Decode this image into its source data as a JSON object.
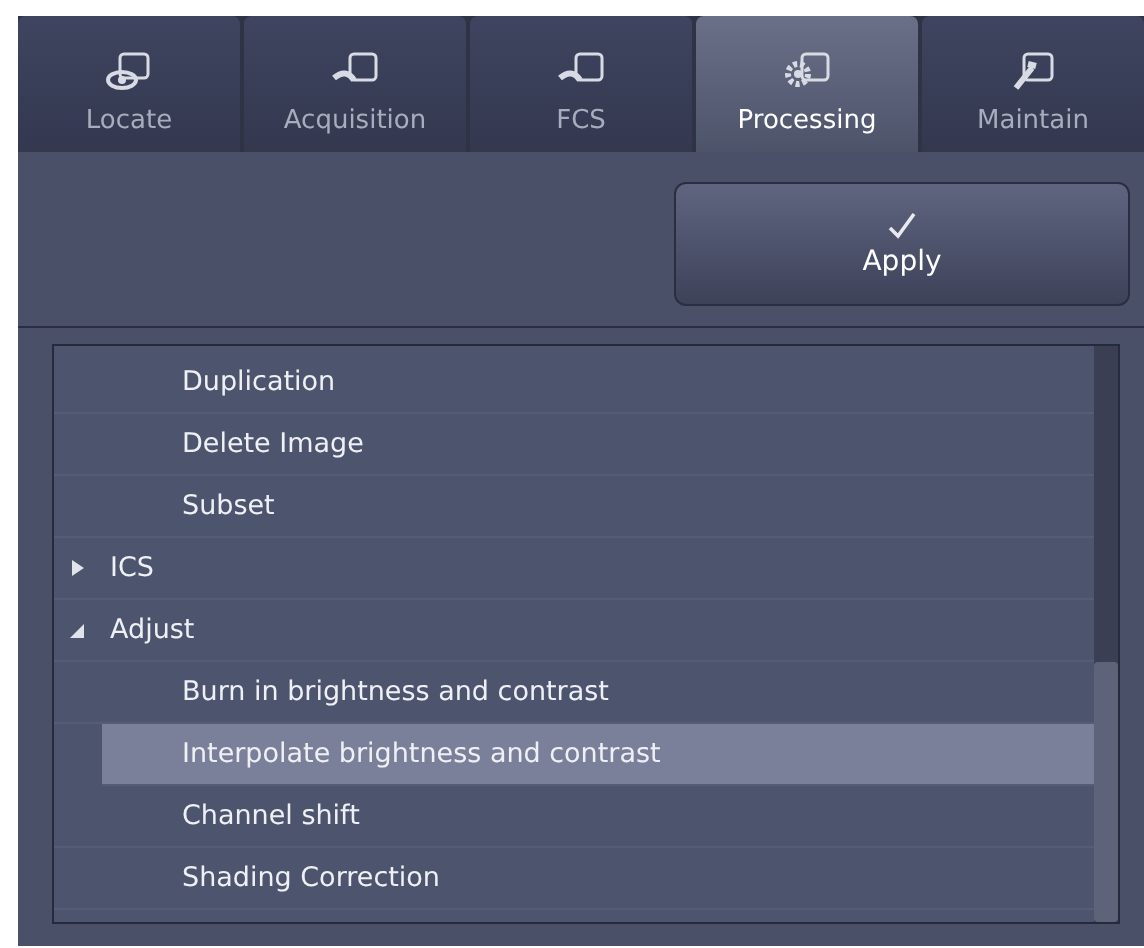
{
  "tabs": [
    {
      "label": "Locate",
      "selected": false
    },
    {
      "label": "Acquisition",
      "selected": false
    },
    {
      "label": "FCS",
      "selected": false
    },
    {
      "label": "Processing",
      "selected": true
    },
    {
      "label": "Maintain",
      "selected": false
    }
  ],
  "apply_button": {
    "label": "Apply"
  },
  "tree": [
    {
      "kind": "leaf",
      "label": "Duplication",
      "selected": false
    },
    {
      "kind": "leaf",
      "label": "Delete Image",
      "selected": false
    },
    {
      "kind": "leaf",
      "label": "Subset",
      "selected": false
    },
    {
      "kind": "group",
      "label": "ICS",
      "expanded": false,
      "selected": false
    },
    {
      "kind": "group",
      "label": "Adjust",
      "expanded": true,
      "selected": false,
      "children": [
        {
          "kind": "leaf",
          "label": "Burn in brightness and contrast",
          "selected": false
        },
        {
          "kind": "leaf",
          "label": "Interpolate brightness and contrast",
          "selected": true
        },
        {
          "kind": "leaf",
          "label": "Channel shift",
          "selected": false
        },
        {
          "kind": "leaf",
          "label": "Shading Correction",
          "selected": false
        }
      ]
    }
  ]
}
